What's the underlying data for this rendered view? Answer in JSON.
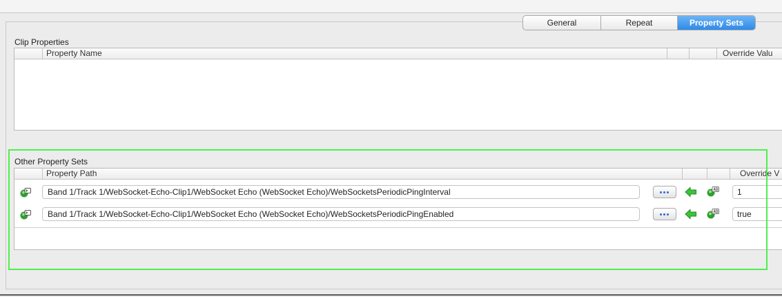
{
  "tabs": [
    {
      "label": "General"
    },
    {
      "label": "Repeat"
    },
    {
      "label": "Property Sets"
    }
  ],
  "clip_properties": {
    "title": "Clip Properties",
    "columns": {
      "property_name": "Property Name",
      "override_value": "Override Valu"
    }
  },
  "other_property_sets": {
    "title": "Other Property Sets",
    "columns": {
      "property_path": "Property Path",
      "override_value": "Override V"
    },
    "rows": [
      {
        "path": "Band 1/Track 1/WebSocket-Echo-Clip1/WebSocket Echo (WebSocket Echo)/WebSocketsPeriodicPingInterval",
        "value": "1"
      },
      {
        "path": "Band 1/Track 1/WebSocket-Echo-Clip1/WebSocket Echo (WebSocket Echo)/WebSocketsPeriodicPingEnabled",
        "value": "true"
      }
    ]
  },
  "icons": {
    "row_icon": "script-node-icon",
    "browse": "ellipsis-icon",
    "apply": "green-left-arrow-icon",
    "ab": "ab-node-icon"
  },
  "colors": {
    "selected_tab": "#2f8ae8",
    "highlight": "#4df04d",
    "arrow_green": "#3cc43c"
  }
}
